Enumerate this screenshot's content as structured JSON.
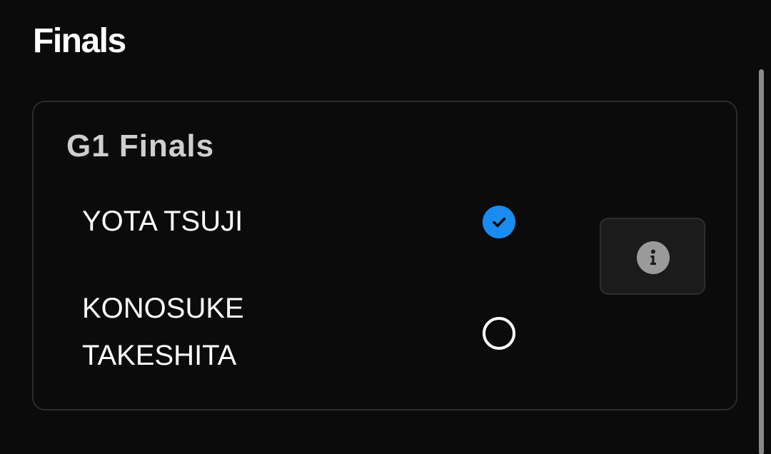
{
  "section": {
    "title": "Finals"
  },
  "card": {
    "title": "G1 Finals",
    "options": [
      {
        "label": "YOTA TSUJI",
        "selected": true
      },
      {
        "label": "KONOSUKE\nTAKESHITA",
        "selected": false
      }
    ],
    "info_button": {
      "icon": "info-icon"
    }
  },
  "colors": {
    "background": "#0b0b0b",
    "selected_radio": "#1a8cf0",
    "card_border": "#2b2b2b",
    "info_button_bg": "#1b1b1b",
    "info_icon_bg": "#9a9a9a"
  }
}
